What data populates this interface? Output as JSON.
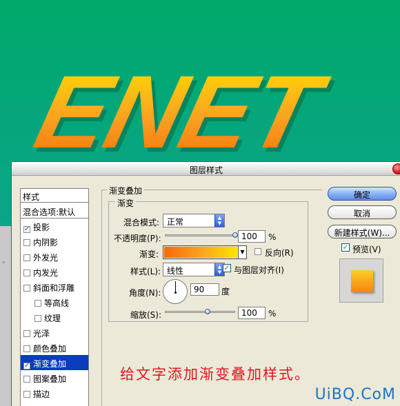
{
  "hero": {
    "text": "ENET"
  },
  "dialog": {
    "title": "图层样式",
    "style_list": {
      "header": "样式",
      "blend_options": "混合选项:默认",
      "items": [
        {
          "label": "投影",
          "checked": true
        },
        {
          "label": "内阴影",
          "checked": false
        },
        {
          "label": "外发光",
          "checked": false
        },
        {
          "label": "内发光",
          "checked": false
        },
        {
          "label": "斜面和浮雕",
          "checked": false
        },
        {
          "label": "等高线",
          "checked": false
        },
        {
          "label": "纹理",
          "checked": false
        },
        {
          "label": "光泽",
          "checked": false
        },
        {
          "label": "颜色叠加",
          "checked": false
        },
        {
          "label": "渐变叠加",
          "checked": true,
          "selected": true
        },
        {
          "label": "图案叠加",
          "checked": false
        },
        {
          "label": "描边",
          "checked": false
        }
      ]
    },
    "gradient_overlay": {
      "section_title": "渐变叠加",
      "group_title": "渐变",
      "blend_mode": {
        "label": "混合模式:",
        "value": "正常"
      },
      "opacity": {
        "label": "不透明度(P):",
        "value": "100",
        "unit": "%",
        "level": 1.0
      },
      "gradient": {
        "label": "渐变:",
        "reverse_label": "反向(R)",
        "reverse": false,
        "colors": [
          "#f46b0a",
          "#fba220",
          "#ffe400"
        ]
      },
      "style": {
        "label": "样式(L):",
        "value": "线性",
        "align_label": "与图层对齐(I)",
        "align": true
      },
      "angle": {
        "label": "角度(N):",
        "value": "90",
        "unit": "度"
      },
      "scale": {
        "label": "缩放(S):",
        "value": "100",
        "unit": "%",
        "level": 0.5
      }
    },
    "buttons": {
      "ok": "确定",
      "cancel": "取消",
      "new_style": "新建样式(W)...",
      "preview_label": "预览(V)",
      "preview": true
    }
  },
  "caption": "给文字添加渐变叠加样式。",
  "watermark": "UiBQ.CoM",
  "colors": {
    "background_top": "#00a869",
    "background_bottom": "#17a3a0",
    "accent": "#0a3cbf",
    "caption": "#e0151f"
  }
}
